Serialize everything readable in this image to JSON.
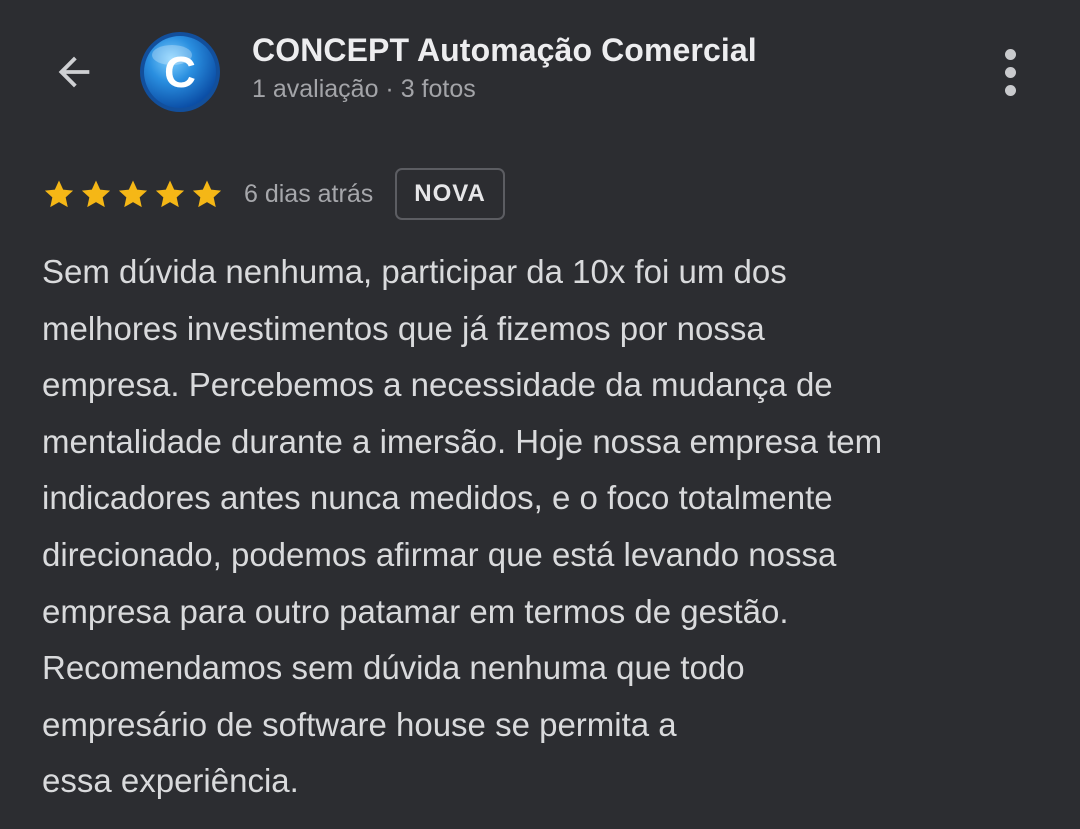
{
  "header": {
    "title": "CONCEPT Automação Comercial",
    "subtitle": "1 avaliação · 3 fotos",
    "avatar_letter": "C"
  },
  "review": {
    "rating": 5,
    "rating_max": 5,
    "date": "6 dias atrás",
    "badge": "NOVA",
    "text_lines": [
      "Sem dúvida nenhuma, participar da 10x foi um dos",
      "melhores investimentos que já fizemos por nossa",
      "empresa. Percebemos a necessidade da mudança de",
      "mentalidade durante a imersão. Hoje nossa empresa tem",
      "indicadores antes nunca medidos, e o foco totalmente",
      "direcionado, podemos afirmar que está levando nossa",
      "empresa para outro patamar em termos de gestão.",
      "Recomendamos sem dúvida nenhuma que todo",
      "empresário de software house se permita a",
      "essa experiência."
    ]
  },
  "icons": {
    "back": "arrow-back-icon",
    "more": "more-vertical-icon",
    "star": "star-icon"
  },
  "colors": {
    "background": "#2c2d31",
    "star": "#f5b716",
    "avatar_blue": "#1b7fd4"
  }
}
